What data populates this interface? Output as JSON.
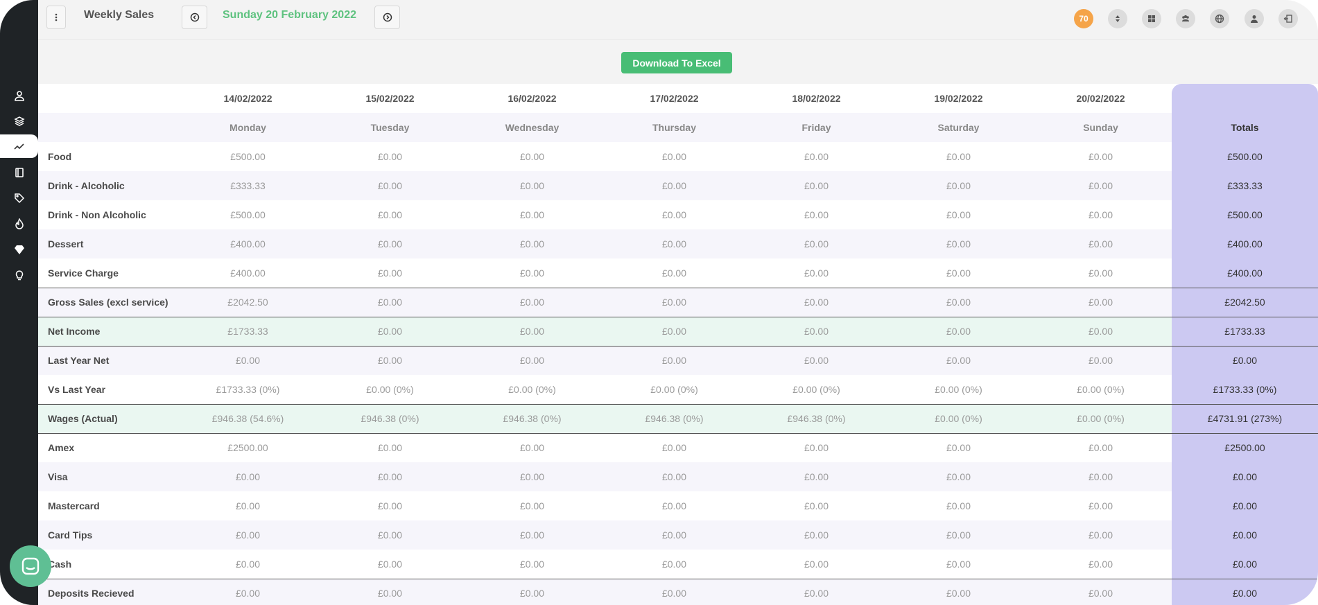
{
  "header": {
    "title": "Weekly Sales",
    "date": "Sunday 20 February 2022",
    "notification_count": "70",
    "download_label": "Download To Excel"
  },
  "colors": {
    "accent_green": "#48bd75",
    "date_green": "#5ec27f",
    "badge_orange": "#f5a449",
    "totals_purple": "#ccc9f2",
    "sidebar_dark": "#1f2326"
  },
  "sidebar": {
    "items": [
      {
        "icon": "user-icon"
      },
      {
        "icon": "layers-icon"
      },
      {
        "icon": "trend-line-icon",
        "active": true
      },
      {
        "icon": "book-icon"
      },
      {
        "icon": "tag-icon"
      },
      {
        "icon": "flame-icon"
      },
      {
        "icon": "diamond-icon"
      },
      {
        "icon": "lightbulb-icon"
      }
    ]
  },
  "toolbar_icons": [
    "sort-icon",
    "grid-icon",
    "users-icon",
    "globe-icon",
    "profile-icon",
    "logout-icon"
  ],
  "table": {
    "dates": [
      "14/02/2022",
      "15/02/2022",
      "16/02/2022",
      "17/02/2022",
      "18/02/2022",
      "19/02/2022",
      "20/02/2022"
    ],
    "days": [
      "Monday",
      "Tuesday",
      "Wednesday",
      "Thursday",
      "Friday",
      "Saturday",
      "Sunday"
    ],
    "totals_header": "Totals",
    "rows": [
      {
        "label": "Food",
        "values": [
          "£500.00",
          "£0.00",
          "£0.00",
          "£0.00",
          "£0.00",
          "£0.00",
          "£0.00"
        ],
        "total": "£500.00"
      },
      {
        "label": "Drink - Alcoholic",
        "values": [
          "£333.33",
          "£0.00",
          "£0.00",
          "£0.00",
          "£0.00",
          "£0.00",
          "£0.00"
        ],
        "total": "£333.33"
      },
      {
        "label": "Drink - Non Alcoholic",
        "values": [
          "£500.00",
          "£0.00",
          "£0.00",
          "£0.00",
          "£0.00",
          "£0.00",
          "£0.00"
        ],
        "total": "£500.00"
      },
      {
        "label": "Dessert",
        "values": [
          "£400.00",
          "£0.00",
          "£0.00",
          "£0.00",
          "£0.00",
          "£0.00",
          "£0.00"
        ],
        "total": "£400.00"
      },
      {
        "label": "Service Charge",
        "values": [
          "£400.00",
          "£0.00",
          "£0.00",
          "£0.00",
          "£0.00",
          "£0.00",
          "£0.00"
        ],
        "total": "£400.00"
      },
      {
        "label": "Gross Sales (excl service)",
        "values": [
          "£2042.50",
          "£0.00",
          "£0.00",
          "£0.00",
          "£0.00",
          "£0.00",
          "£0.00"
        ],
        "total": "£2042.50"
      },
      {
        "label": "Net Income",
        "values": [
          "£1733.33",
          "£0.00",
          "£0.00",
          "£0.00",
          "£0.00",
          "£0.00",
          "£0.00"
        ],
        "total": "£1733.33"
      },
      {
        "label": "Last Year Net",
        "values": [
          "£0.00",
          "£0.00",
          "£0.00",
          "£0.00",
          "£0.00",
          "£0.00",
          "£0.00"
        ],
        "total": "£0.00"
      },
      {
        "label": "Vs Last Year",
        "values": [
          "£1733.33 (0%)",
          "£0.00 (0%)",
          "£0.00 (0%)",
          "£0.00 (0%)",
          "£0.00 (0%)",
          "£0.00 (0%)",
          "£0.00 (0%)"
        ],
        "total": "£1733.33 (0%)"
      },
      {
        "label": "Wages (Actual)",
        "values": [
          "£946.38 (54.6%)",
          "£946.38 (0%)",
          "£946.38 (0%)",
          "£946.38 (0%)",
          "£946.38 (0%)",
          "£0.00 (0%)",
          "£0.00 (0%)"
        ],
        "total": "£4731.91 (273%)"
      },
      {
        "label": "Amex",
        "values": [
          "£2500.00",
          "£0.00",
          "£0.00",
          "£0.00",
          "£0.00",
          "£0.00",
          "£0.00"
        ],
        "total": "£2500.00"
      },
      {
        "label": "Visa",
        "values": [
          "£0.00",
          "£0.00",
          "£0.00",
          "£0.00",
          "£0.00",
          "£0.00",
          "£0.00"
        ],
        "total": "£0.00"
      },
      {
        "label": "Mastercard",
        "values": [
          "£0.00",
          "£0.00",
          "£0.00",
          "£0.00",
          "£0.00",
          "£0.00",
          "£0.00"
        ],
        "total": "£0.00"
      },
      {
        "label": "Card Tips",
        "values": [
          "£0.00",
          "£0.00",
          "£0.00",
          "£0.00",
          "£0.00",
          "£0.00",
          "£0.00"
        ],
        "total": "£0.00"
      },
      {
        "label": "Cash",
        "values": [
          "£0.00",
          "£0.00",
          "£0.00",
          "£0.00",
          "£0.00",
          "£0.00",
          "£0.00"
        ],
        "total": "£0.00"
      },
      {
        "label": "Deposits Recieved",
        "values": [
          "£0.00",
          "£0.00",
          "£0.00",
          "£0.00",
          "£0.00",
          "£0.00",
          "£0.00"
        ],
        "total": "£0.00"
      }
    ]
  }
}
